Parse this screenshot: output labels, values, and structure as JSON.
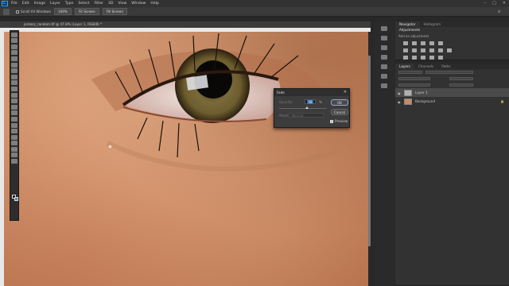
{
  "menubar": {
    "logo": "Ps",
    "items": [
      "File",
      "Edit",
      "Image",
      "Layer",
      "Type",
      "Select",
      "Filter",
      "3D",
      "View",
      "Window",
      "Help"
    ],
    "window_controls": [
      "–",
      "□",
      "✕"
    ]
  },
  "options_bar": {
    "scroll_all_windows": "Scroll All Windows",
    "zoom": "100%",
    "fit_screen": "Fit Screen",
    "fill_screen": "Fill Screen"
  },
  "document": {
    "tab_title": "jorkesz_random.tif @ 47.8% (Layer 1, RGB/8) *"
  },
  "panels": {
    "top_tabs": [
      "Navigator",
      "Histogram"
    ],
    "adjustments_tab": "Adjustments",
    "add_adjustment": "Add an adjustment",
    "layers_tabs": [
      "Layers",
      "Channels",
      "Paths"
    ],
    "layers": [
      {
        "name": "Layer 1",
        "selected": true
      },
      {
        "name": "Background",
        "selected": false
      }
    ]
  },
  "fade_dialog": {
    "title": "Fade",
    "opacity_label": "Opacity:",
    "opacity_value": "58",
    "opacity_unit": "%",
    "mode_label": "Mode:",
    "mode_value": "Normal",
    "ok": "OK",
    "cancel": "Cancel",
    "preview": "Preview",
    "opacity_fraction": 0.58
  },
  "colors": {
    "foreground": "#111111",
    "background": "#3a8fd6",
    "ui_dark": "#282828",
    "accent": "#31a8ff"
  }
}
